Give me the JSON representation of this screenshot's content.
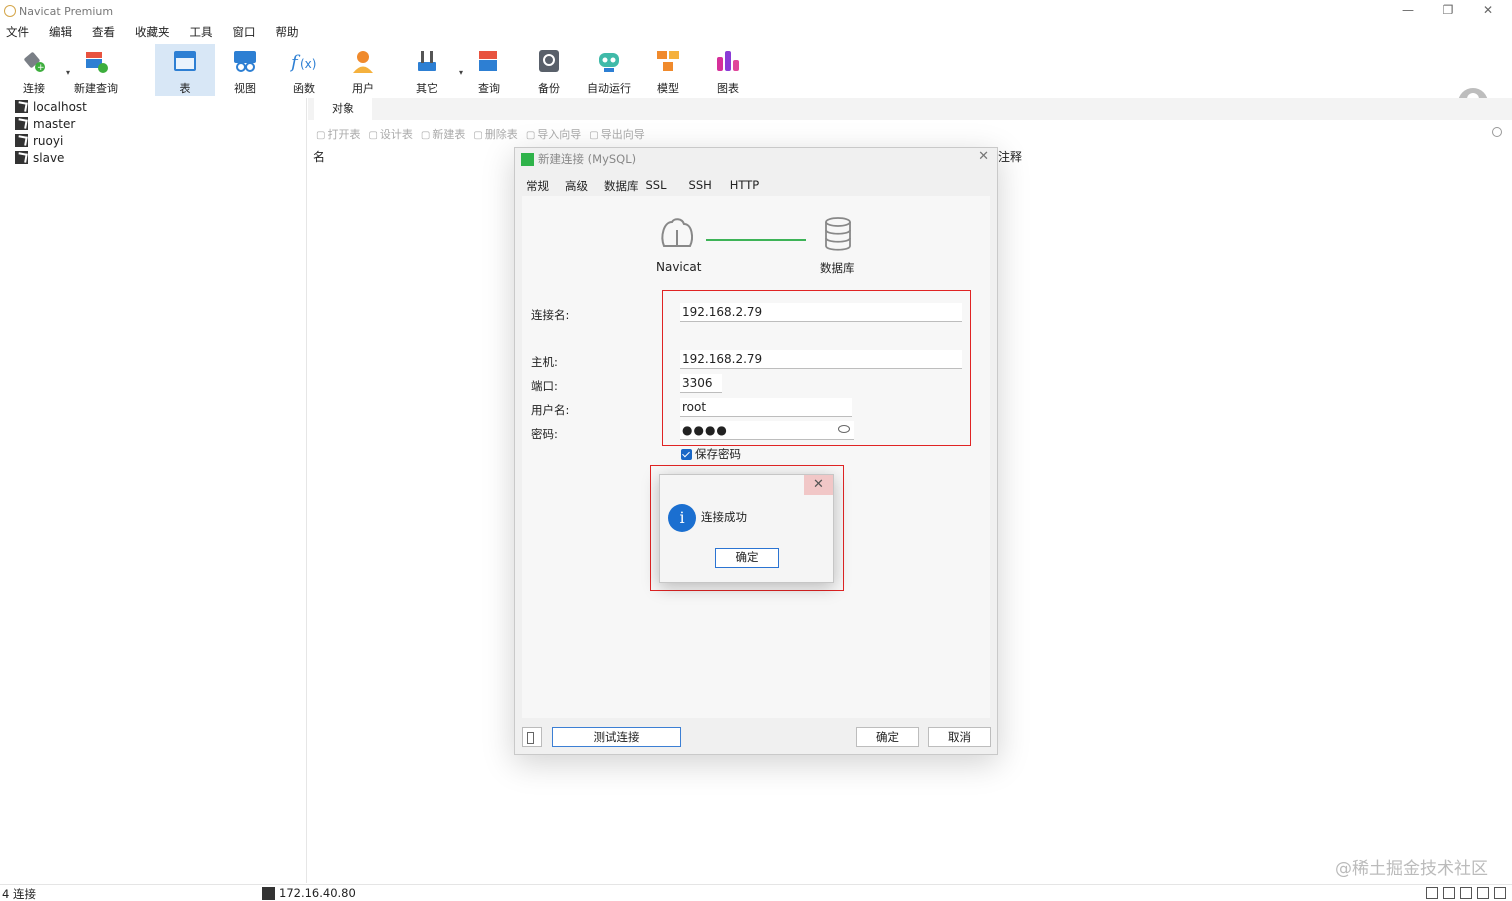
{
  "app": {
    "title": "Navicat Premium",
    "minimize": "—",
    "restore": "❐",
    "close": "✕"
  },
  "menu": [
    "文件",
    "编辑",
    "查看",
    "收藏夹",
    "工具",
    "窗口",
    "帮助"
  ],
  "toolbar": {
    "items": [
      {
        "label": "连接",
        "icon": "plug-icon"
      },
      {
        "label": "新建查询",
        "icon": "new-query-icon"
      },
      {
        "label": "表",
        "icon": "table-icon"
      },
      {
        "label": "视图",
        "icon": "view-icon"
      },
      {
        "label": "函数",
        "icon": "function-icon"
      },
      {
        "label": "用户",
        "icon": "user-icon"
      },
      {
        "label": "其它",
        "icon": "tools-icon"
      },
      {
        "label": "查询",
        "icon": "query-icon"
      },
      {
        "label": "备份",
        "icon": "backup-icon"
      },
      {
        "label": "自动运行",
        "icon": "robot-icon"
      },
      {
        "label": "模型",
        "icon": "model-icon"
      },
      {
        "label": "图表",
        "icon": "chart-icon"
      }
    ],
    "active": "表"
  },
  "nav": {
    "connections": [
      "localhost",
      "master",
      "ruoyi",
      "slave"
    ]
  },
  "objects": {
    "tab": "对象",
    "tools": [
      "打开表",
      "设计表",
      "新建表",
      "删除表",
      "导入向导",
      "导出向导"
    ],
    "col_name": "名",
    "col_comment": "注释"
  },
  "dialog": {
    "title": "新建连接 (MySQL)",
    "tabs": [
      "常规",
      "高级",
      "数据库",
      "SSL",
      "SSH",
      "HTTP"
    ],
    "left_logo_label": "Navicat",
    "right_logo_label": "数据库",
    "fields": {
      "conn_name": {
        "label": "连接名:",
        "value": "192.168.2.79"
      },
      "host": {
        "label": "主机:",
        "value": "192.168.2.79"
      },
      "port": {
        "label": "端口:",
        "value": "3306"
      },
      "user": {
        "label": "用户名:",
        "value": "root"
      },
      "password": {
        "label": "密码:",
        "value": "●●●●"
      }
    },
    "save_password": "保存密码",
    "test_button": "测试连接",
    "ok_button": "确定",
    "cancel_button": "取消"
  },
  "message": {
    "text": "连接成功",
    "ok": "确定",
    "close": "✕"
  },
  "status": {
    "count": "4 连接",
    "server": "172.16.40.80"
  },
  "watermark": "@稀土掘金技术社区",
  "colors": {
    "accent": "#1b6fd0",
    "highlight_box": "#e02424",
    "connection_line": "#3db357",
    "active_tool": "#d8e7f6"
  }
}
